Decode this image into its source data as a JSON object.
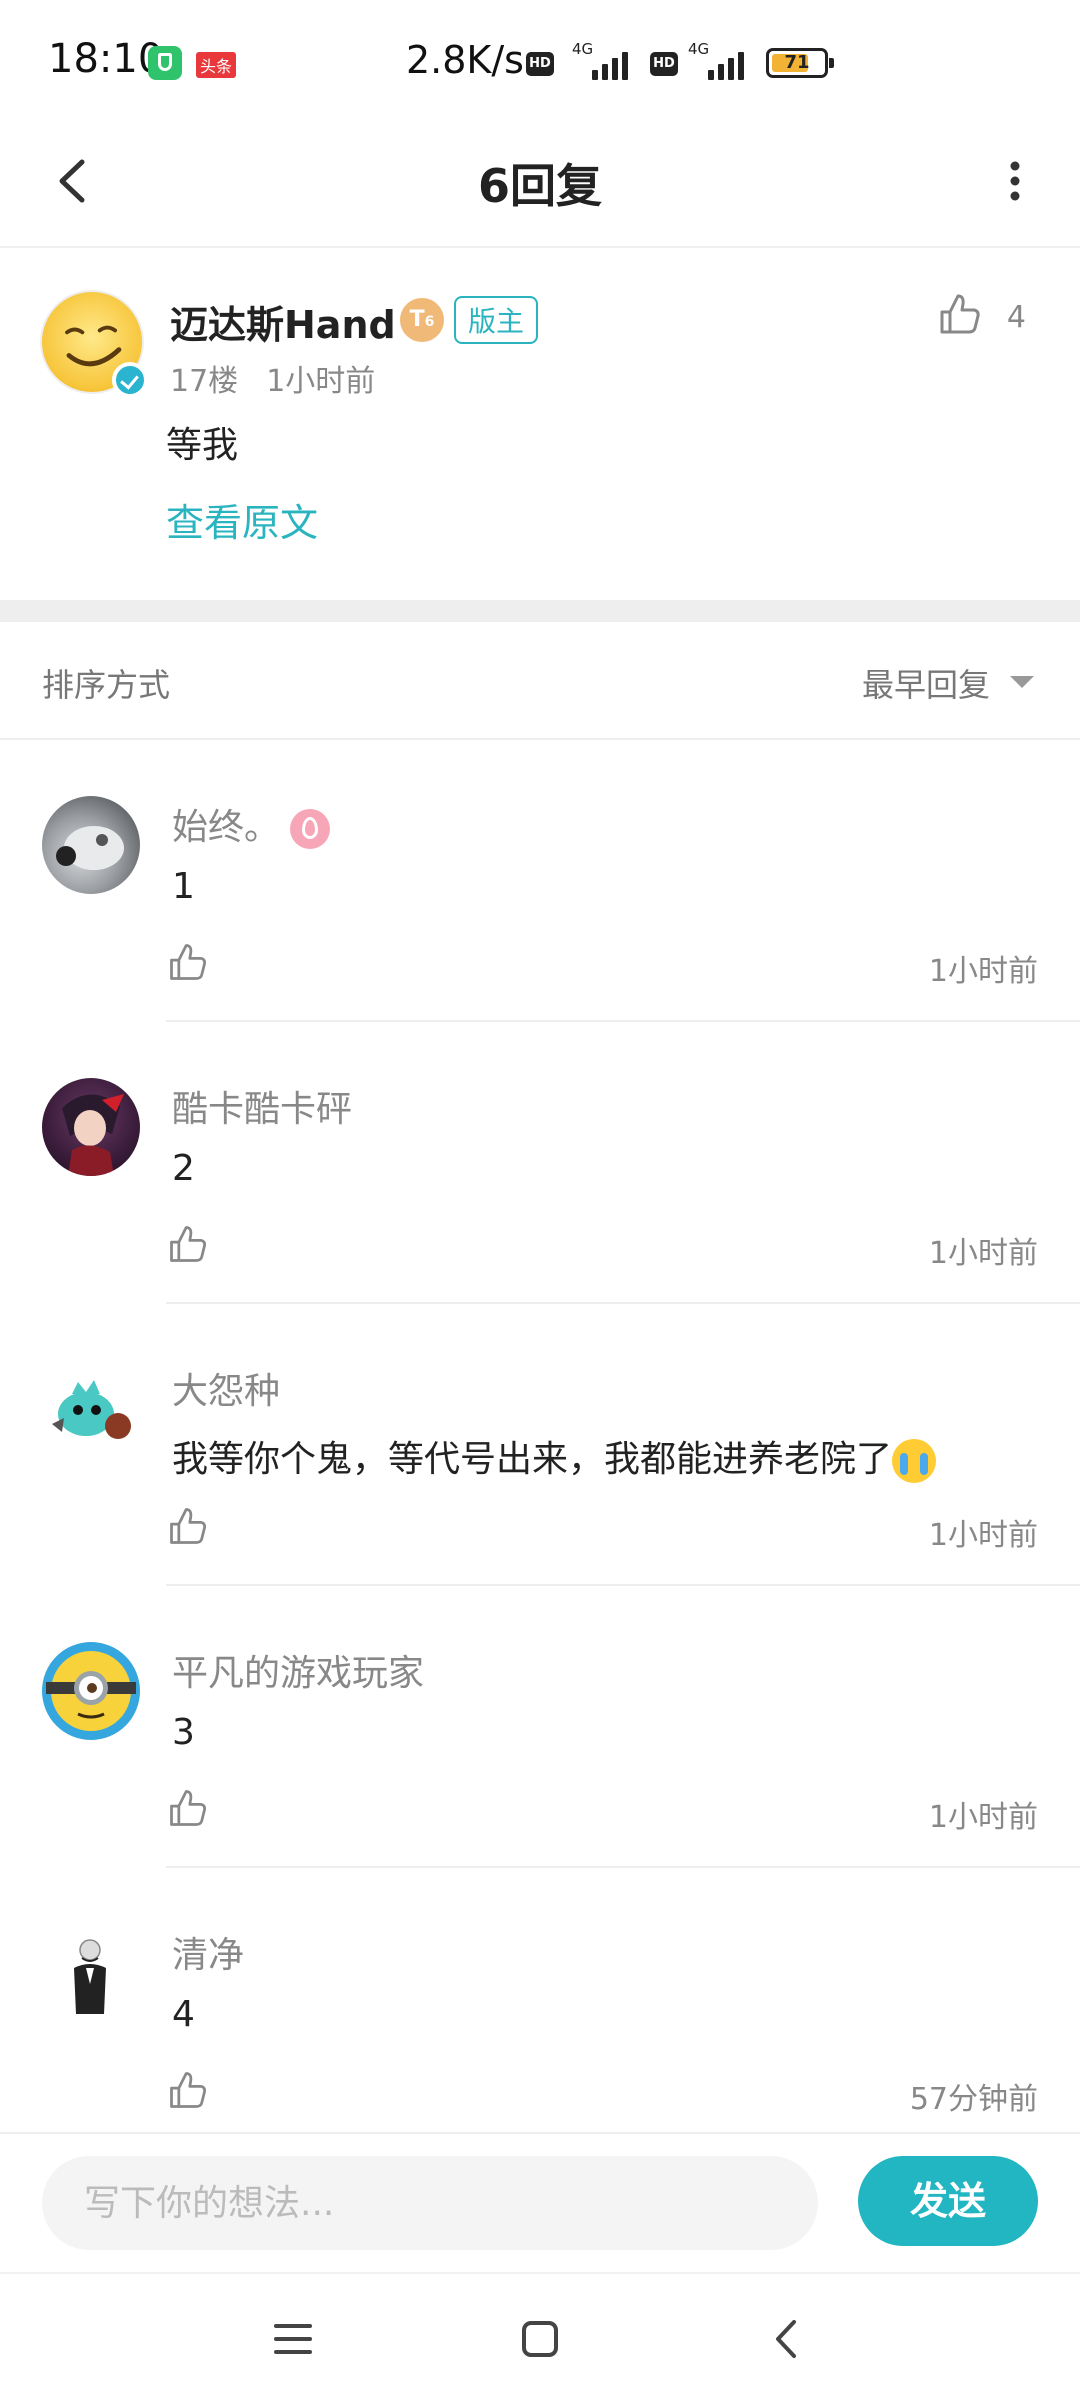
{
  "status_bar": {
    "time": "18:10",
    "toutiao_badge": "头条",
    "net_speed": "2.8K/s",
    "hd_label": "HD",
    "network_type": "4G",
    "battery": "71",
    "battery_level": 0.71
  },
  "header": {
    "title": "6回复"
  },
  "post": {
    "author": "迈达斯Hand",
    "level": "6",
    "moderator_badge": "版主",
    "floor": "17楼",
    "time": "1小时前",
    "likes": "4",
    "text": "等我",
    "view_original": "查看原文"
  },
  "sort": {
    "label": "排序方式",
    "value": "最早回复"
  },
  "replies": [
    {
      "name": "始终。",
      "text": "1",
      "time": "1小时前"
    },
    {
      "name": "酷卡酷卡砰",
      "text": "2",
      "time": "1小时前"
    },
    {
      "name": "大怨种",
      "text": "我等你个鬼，等代号出来，我都能进养老院了",
      "time": "1小时前"
    },
    {
      "name": "平凡的游戏玩家",
      "text": "3",
      "time": "1小时前"
    },
    {
      "name": "清净",
      "text": "4",
      "time": "57分钟前"
    }
  ],
  "composer": {
    "placeholder": "写下你的想法...",
    "send_label": "发送"
  },
  "colors": {
    "accent": "#22b5c2",
    "battery_fill": "#f2b233"
  }
}
